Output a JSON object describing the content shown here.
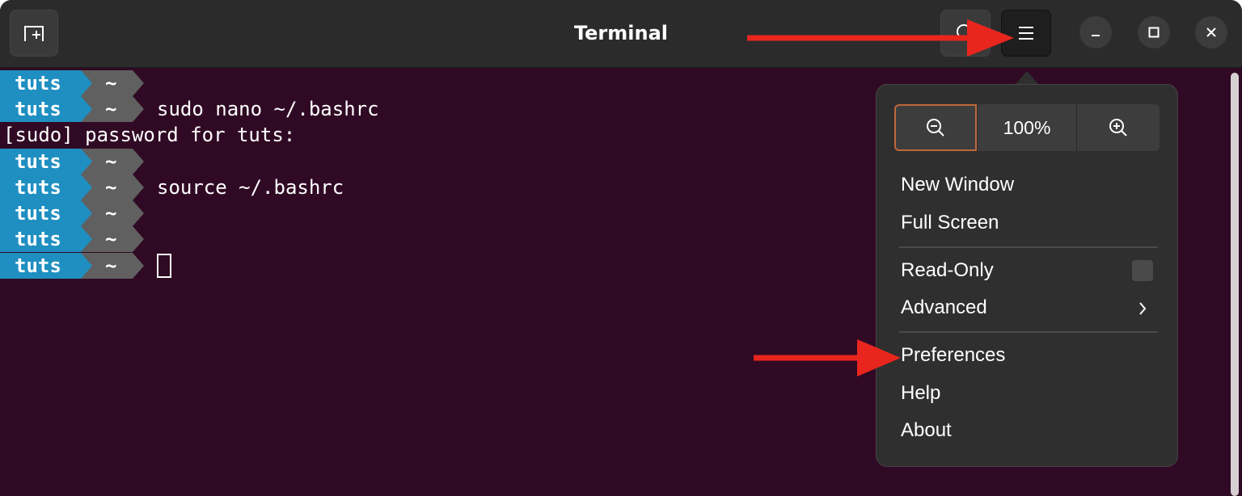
{
  "window": {
    "title": "Terminal"
  },
  "terminal": {
    "prompt_user": "tuts",
    "prompt_dir": "~",
    "lines": [
      {
        "type": "prompt",
        "cmd": ""
      },
      {
        "type": "prompt",
        "cmd": "sudo nano ~/.bashrc"
      },
      {
        "type": "plain",
        "text": "[sudo] password for tuts:"
      },
      {
        "type": "prompt",
        "cmd": ""
      },
      {
        "type": "prompt",
        "cmd": "source ~/.bashrc"
      },
      {
        "type": "prompt",
        "cmd": ""
      },
      {
        "type": "prompt",
        "cmd": ""
      },
      {
        "type": "prompt",
        "cmd": "",
        "cursor": true
      }
    ]
  },
  "menu": {
    "zoom_level": "100%",
    "items": {
      "new_window": "New Window",
      "full_screen": "Full Screen",
      "read_only": "Read-Only",
      "advanced": "Advanced",
      "preferences": "Preferences",
      "help": "Help",
      "about": "About"
    },
    "read_only_checked": false
  },
  "colors": {
    "terminal_bg": "#300a24",
    "prompt_user_bg": "#1f8fc1",
    "prompt_dir_bg": "#606060",
    "annotation_arrow": "#e8261e"
  },
  "icons": [
    "new-tab-icon",
    "search-icon",
    "hamburger-menu-icon",
    "minimize-icon",
    "maximize-icon",
    "close-icon",
    "zoom-out-icon",
    "zoom-in-icon",
    "chevron-right-icon"
  ]
}
